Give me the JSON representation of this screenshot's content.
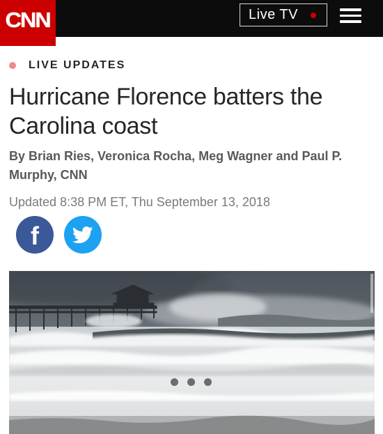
{
  "header": {
    "logo": "CNN",
    "live_tv": "Live TV",
    "menu_icon": "hamburger-menu-icon"
  },
  "article": {
    "live_label": "LIVE UPDATES",
    "headline": "Hurricane Florence batters the Carolina coast",
    "byline": "By Brian Ries, Veronica Rocha, Meg Wagner and Paul P. Murphy, CNN",
    "updated": "Updated 8:38 PM ET, Thu September 13, 2018"
  },
  "share": {
    "facebook_icon": "facebook-icon",
    "facebook_glyph": "f",
    "twitter_icon": "twitter-icon"
  },
  "media": {
    "image": "hurricane-pier-surf-photo",
    "gallery_dots": 3
  },
  "colors": {
    "brand_red": "#cc0000",
    "topbar": "#0c0c0c",
    "facebook": "#3b5998",
    "twitter": "#1da1f2",
    "live_bullet": "#f08b8b"
  }
}
